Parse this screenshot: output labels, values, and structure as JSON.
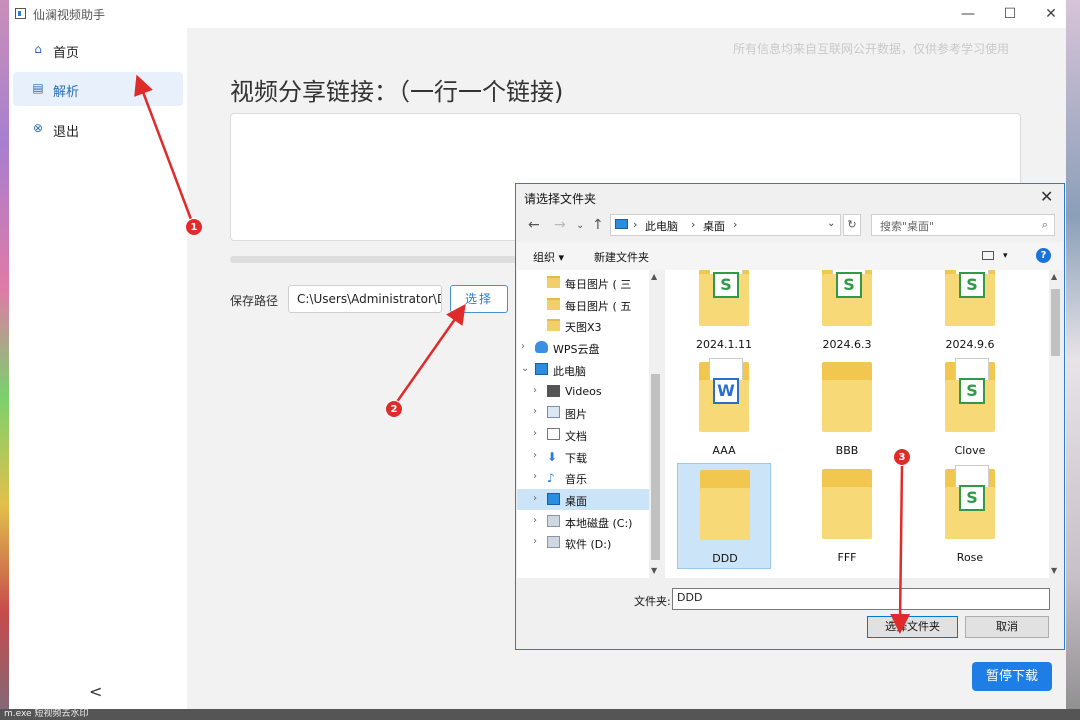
{
  "app": {
    "title": "仙澜视频助手",
    "window_controls": {
      "minimize": "—",
      "maximize": "☐",
      "close": "✕"
    }
  },
  "sidebar": {
    "items": [
      {
        "label": "首页",
        "icon": "home-icon",
        "glyph": "⌂"
      },
      {
        "label": "解析",
        "icon": "parse-icon",
        "glyph": "▤"
      },
      {
        "label": "退出",
        "icon": "exit-icon",
        "glyph": "⊗"
      }
    ],
    "active_index": 1,
    "collapse_glyph": "<"
  },
  "main": {
    "notice": "所有信息均来自互联网公开数据，仅供参考学习使用",
    "heading": "视频分享链接：（一行一个链接)",
    "links_text": "",
    "save_label": "保存路径",
    "save_path": "C:\\Users\\Administrator\\Desktop",
    "choose_button": "选择",
    "pause_button": "暂停下载"
  },
  "dialog": {
    "title": "请选择文件夹",
    "breadcrumb": [
      "此电脑",
      "桌面"
    ],
    "search_placeholder": "搜索\"桌面\"",
    "toolbar": {
      "organize": "组织 ▾",
      "new_folder": "新建文件夹",
      "help": "?"
    },
    "tree": [
      {
        "label": "每日图片 ( 三",
        "icon": "folder",
        "indent": 1,
        "chev": ""
      },
      {
        "label": "每日图片 ( 五",
        "icon": "folder",
        "indent": 1,
        "chev": ""
      },
      {
        "label": "天图X3",
        "icon": "folder",
        "indent": 1,
        "chev": ""
      },
      {
        "label": "WPS云盘",
        "icon": "cloud",
        "indent": 0,
        "chev": ">"
      },
      {
        "label": "此电脑",
        "icon": "pc",
        "indent": 0,
        "chev": "v"
      },
      {
        "label": "Videos",
        "icon": "video",
        "indent": 1,
        "chev": ">"
      },
      {
        "label": "图片",
        "icon": "image",
        "indent": 1,
        "chev": ">"
      },
      {
        "label": "文档",
        "icon": "doc",
        "indent": 1,
        "chev": ">"
      },
      {
        "label": "下载",
        "icon": "download",
        "indent": 1,
        "chev": ">"
      },
      {
        "label": "音乐",
        "icon": "music",
        "indent": 1,
        "chev": ">"
      },
      {
        "label": "桌面",
        "icon": "pc",
        "indent": 1,
        "chev": ">",
        "selected": true
      },
      {
        "label": "本地磁盘 (C:)",
        "icon": "drive",
        "indent": 1,
        "chev": ">"
      },
      {
        "label": "软件 (D:)",
        "icon": "drive",
        "indent": 1,
        "chev": ">"
      }
    ],
    "files": [
      {
        "name": "2024.1.11",
        "badge": "S"
      },
      {
        "name": "2024.6.3",
        "badge": "S"
      },
      {
        "name": "2024.9.6",
        "badge": "S"
      },
      {
        "name": "AAA",
        "badge": "W"
      },
      {
        "name": "BBB",
        "badge": ""
      },
      {
        "name": "Clove",
        "badge": "S"
      },
      {
        "name": "DDD",
        "badge": "",
        "selected": true
      },
      {
        "name": "FFF",
        "badge": ""
      },
      {
        "name": "Rose",
        "badge": "S"
      }
    ],
    "folder_label": "文件夹:",
    "folder_value": "DDD",
    "select_button": "选择文件夹",
    "cancel_button": "取消"
  },
  "annotations": [
    "1",
    "2",
    "3"
  ],
  "desktop": {
    "taskbar_text": "m.exe     短视频去水印"
  },
  "colors": {
    "accent": "#1e7ee6",
    "annotation": "#e02b2b",
    "active_nav_bg": "#e8f1fb"
  }
}
